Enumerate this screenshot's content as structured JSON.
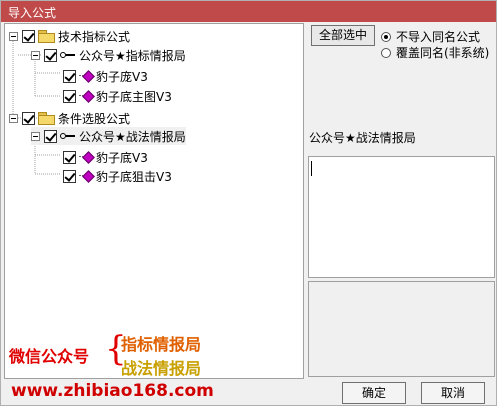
{
  "window": {
    "title": "导入公式"
  },
  "tree": {
    "group1": {
      "label": "技术指标公式",
      "child": {
        "label": "公众号★指标情报局",
        "items": [
          "豹子庞V3",
          "豹子底主图V3"
        ]
      }
    },
    "group2": {
      "label": "条件选股公式",
      "child": {
        "label": "公众号★战法情报局",
        "items": [
          "豹子底V3",
          "豹子底狙击V3"
        ]
      }
    }
  },
  "controls": {
    "select_all": "全部选中",
    "option_skip": "不导入同名公式",
    "option_overwrite": "覆盖同名(非系统)"
  },
  "formula_name": "公众号★战法情报局",
  "watermark": {
    "left": "微信公众号",
    "line1": "指标情报局",
    "line2": "战法情报局",
    "url": "www.zhibiao168.com"
  },
  "buttons": {
    "ok": "确定",
    "cancel": "取消"
  },
  "colors": {
    "titlebar": "#c04a4a",
    "accent_red": "#e00000"
  }
}
